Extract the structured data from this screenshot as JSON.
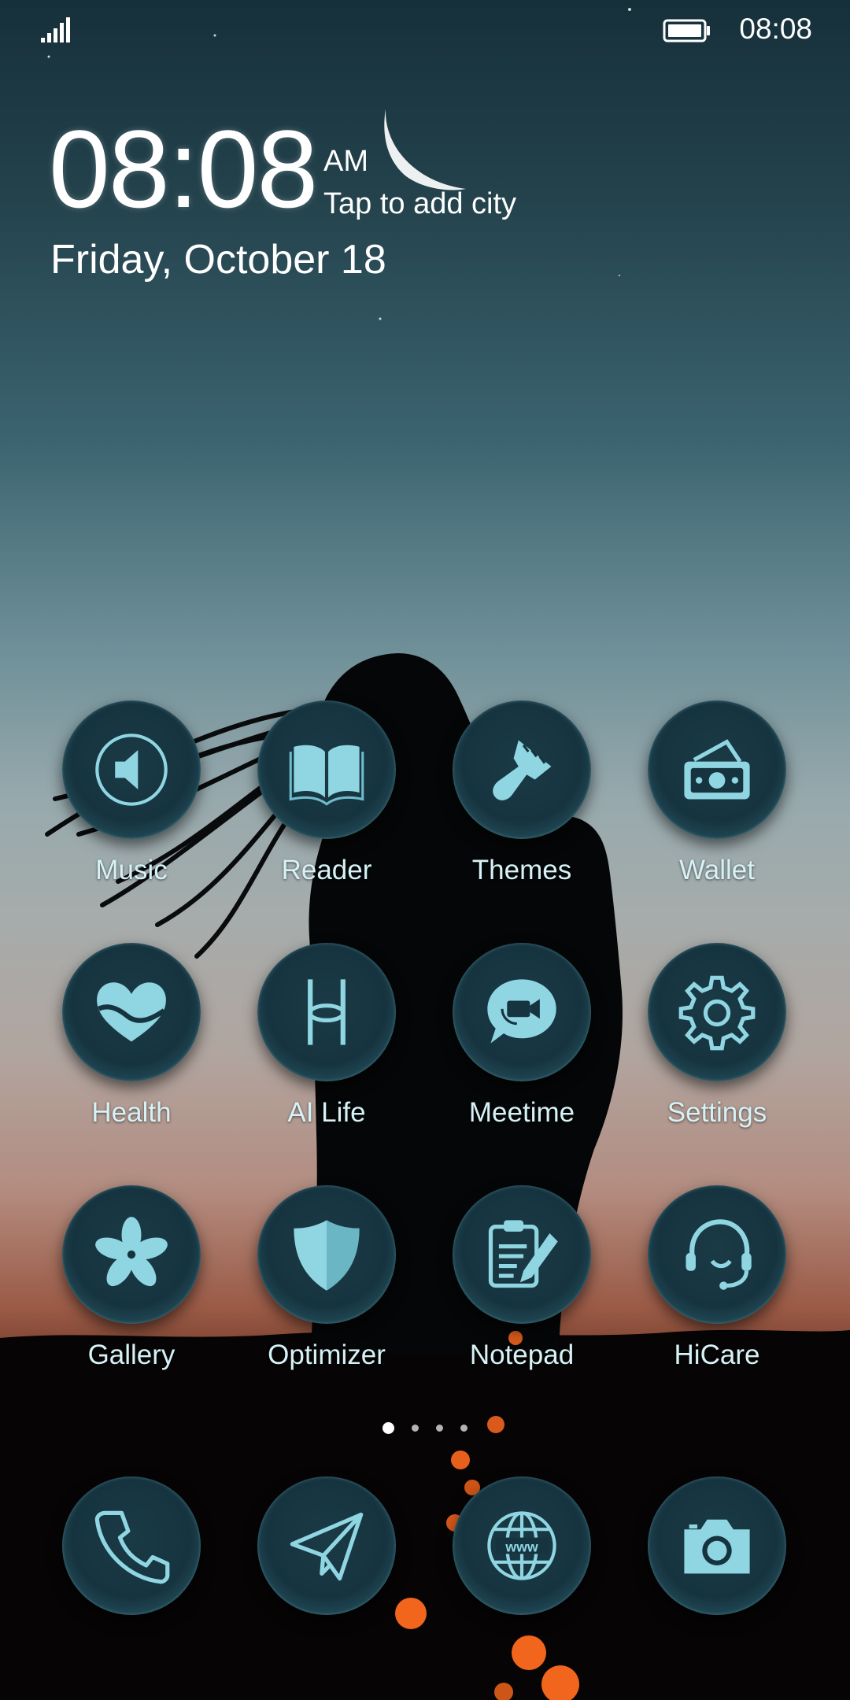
{
  "status_bar": {
    "time": "08:08",
    "signal_icon": "signal-bars-icon",
    "battery_icon": "battery-icon"
  },
  "clock_widget": {
    "time": "08:08",
    "ampm": "AM",
    "city": "Tap to add city",
    "date": "Friday, October 18",
    "weather_icon": "crescent-moon-icon"
  },
  "apps": [
    {
      "label": "Music",
      "icon": "speaker-icon"
    },
    {
      "label": "Reader",
      "icon": "book-icon"
    },
    {
      "label": "Themes",
      "icon": "paintbrush-icon"
    },
    {
      "label": "Wallet",
      "icon": "wallet-icon"
    },
    {
      "label": "Health",
      "icon": "heart-icon"
    },
    {
      "label": "AI Life",
      "icon": "ai-life-icon"
    },
    {
      "label": "Meetime",
      "icon": "video-chat-icon"
    },
    {
      "label": "Settings",
      "icon": "gear-icon"
    },
    {
      "label": "Gallery",
      "icon": "flower-icon"
    },
    {
      "label": "Optimizer",
      "icon": "shield-icon"
    },
    {
      "label": "Notepad",
      "icon": "notepad-icon"
    },
    {
      "label": "HiCare",
      "icon": "headset-icon"
    }
  ],
  "page_indicator": {
    "pages": 4,
    "current": 1
  },
  "dock": [
    {
      "icon": "phone-icon"
    },
    {
      "icon": "paper-plane-icon"
    },
    {
      "icon": "globe-icon"
    },
    {
      "icon": "camera-icon"
    }
  ],
  "colors": {
    "icon_glyph": "#8fd6e2",
    "icon_bg": "#163440",
    "label": "#d6f2f6"
  }
}
